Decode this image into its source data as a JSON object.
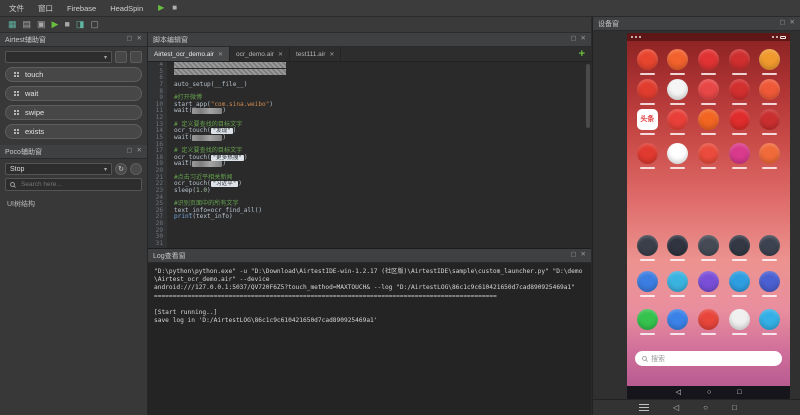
{
  "menubar": {
    "items": [
      "文件",
      "窗口",
      "Firebase",
      "HeadSpin"
    ]
  },
  "menubar_icons": [
    {
      "name": "play-icon",
      "glyph": "▶",
      "color": "#6abf40"
    },
    {
      "name": "stop-icon",
      "glyph": "■",
      "color": "#b0b0b0"
    }
  ],
  "toolbar": {
    "icons": [
      {
        "name": "new-script-icon",
        "glyph": "▦",
        "color": "#5fb3a1"
      },
      {
        "name": "open-script-icon",
        "glyph": "▤",
        "color": "#a8a8a8"
      },
      {
        "name": "save-script-icon",
        "glyph": "▣",
        "color": "#a8a8a8"
      },
      {
        "name": "run-script-icon",
        "glyph": "▶",
        "color": "#6abf40"
      },
      {
        "name": "stop-script-icon",
        "glyph": "■",
        "color": "#a8a8a8"
      },
      {
        "name": "snapshot-icon",
        "glyph": "◨",
        "color": "#5fb3a1"
      },
      {
        "name": "settings-icon",
        "glyph": "▢",
        "color": "#a8a8a8"
      }
    ]
  },
  "left": {
    "airtest": {
      "title": "Airtest辅助窗",
      "actions": [
        "touch",
        "wait",
        "swipe",
        "exists"
      ]
    },
    "poco": {
      "title": "Poco辅助窗",
      "mode": "Stop",
      "search_placeholder": "Search here...",
      "tree_label": "UI树结构"
    }
  },
  "editor": {
    "title": "脚本编辑窗",
    "add_tab": "+",
    "tabs": [
      {
        "label": "Airtest_ocr_demo.air",
        "active": true
      },
      {
        "label": "ocr_demo.air",
        "active": false
      },
      {
        "label": "test111.air",
        "active": false
      }
    ],
    "lines": [
      {
        "n": 4,
        "seg": [
          {
            "s": "redact"
          }
        ]
      },
      {
        "n": 5,
        "seg": [
          {
            "s": "redact"
          }
        ]
      },
      {
        "n": 6,
        "seg": []
      },
      {
        "n": 7,
        "seg": [
          {
            "t": "auto_setup(__file__)",
            "s": "d"
          }
        ]
      },
      {
        "n": 8,
        "seg": []
      },
      {
        "n": 9,
        "seg": [
          {
            "t": "#打开微博",
            "s": "c"
          }
        ]
      },
      {
        "n": 10,
        "seg": [
          {
            "t": "start_app(",
            "s": "d"
          },
          {
            "t": "\"com.sina.weibo\"",
            "s": "s"
          },
          {
            "t": ")",
            "s": "d"
          }
        ]
      },
      {
        "n": 11,
        "seg": [
          {
            "t": "wait(",
            "s": "d"
          },
          {
            "s": "thumb"
          },
          {
            "t": ")",
            "s": "d"
          }
        ]
      },
      {
        "n": 12,
        "seg": []
      },
      {
        "n": 13,
        "seg": [
          {
            "t": "# 定义要查找的目标文字",
            "s": "c"
          }
        ]
      },
      {
        "n": 14,
        "seg": [
          {
            "t": "ocr_touch(",
            "s": "d"
          },
          {
            "t": "\"发现\"",
            "s": "chip"
          },
          {
            "t": ")",
            "s": "d"
          }
        ]
      },
      {
        "n": 15,
        "seg": [
          {
            "t": "wait(",
            "s": "d"
          },
          {
            "s": "thumb"
          },
          {
            "t": ")",
            "s": "d"
          }
        ]
      },
      {
        "n": 16,
        "seg": []
      },
      {
        "n": 17,
        "seg": [
          {
            "t": "# 定义要查找的目标文字",
            "s": "c"
          }
        ]
      },
      {
        "n": 18,
        "seg": [
          {
            "t": "ocr_touch(",
            "s": "d"
          },
          {
            "t": "\"更多热搜\"",
            "s": "chip"
          },
          {
            "t": ")",
            "s": "d"
          }
        ]
      },
      {
        "n": 19,
        "seg": [
          {
            "t": "wait(",
            "s": "d"
          },
          {
            "s": "thumb"
          },
          {
            "t": ")",
            "s": "d"
          }
        ]
      },
      {
        "n": 20,
        "seg": []
      },
      {
        "n": 21,
        "seg": [
          {
            "t": "#点击习近平相关新闻",
            "s": "c"
          }
        ]
      },
      {
        "n": 22,
        "seg": [
          {
            "t": "ocr_touch(",
            "s": "d"
          },
          {
            "t": "\"习近平\"",
            "s": "chip"
          },
          {
            "t": ")",
            "s": "d"
          }
        ]
      },
      {
        "n": 23,
        "seg": [
          {
            "t": "sleep(",
            "s": "d"
          },
          {
            "t": "1.0",
            "s": "n"
          },
          {
            "t": ")",
            "s": "d"
          }
        ]
      },
      {
        "n": 24,
        "seg": []
      },
      {
        "n": 25,
        "seg": [
          {
            "t": "#识别页面中的所有文字",
            "s": "c"
          }
        ]
      },
      {
        "n": 26,
        "seg": [
          {
            "t": "text_info=ocr_find_all()",
            "s": "d"
          }
        ]
      },
      {
        "n": 27,
        "seg": [
          {
            "t": "print",
            "s": "k"
          },
          {
            "t": "(text_info)",
            "s": "d"
          }
        ]
      },
      {
        "n": 28,
        "seg": []
      },
      {
        "n": 29,
        "seg": []
      },
      {
        "n": 30,
        "seg": []
      },
      {
        "n": 31,
        "seg": []
      }
    ]
  },
  "log": {
    "title": "Log查看窗",
    "lines": [
      "\"D:\\python\\python.exe\" -u \"D:\\Download\\AirtestIDE-win-1.2.17 (社区版)\\AirtestIDE\\sample\\custom_launcher.py\" \"D:\\demo\\Airtest_ocr_demo.air\" --device",
      "android:///127.0.0.1:5037/QV720F6Z5?touch_method=MAXTOUCH& --log \"D:/AirtestLOG\\86c1c9c610421650d7cad890925469a1\"",
      "============================================================================================",
      "",
      "[Start running..]",
      "save log in 'D:/AirtestLOG\\86c1c9c610421650d7cad890925469a1'"
    ]
  },
  "device": {
    "title": "设备窗",
    "search_placeholder": "搜索",
    "toutiao_label": "头条",
    "grid": {
      "row_tops": [
        8,
        38,
        68,
        102,
        194,
        230,
        268
      ],
      "rows": [
        {
          "type": "app",
          "colors": [
            "#e8452f",
            "#f2622d",
            "#e13333",
            "#cf2f2f",
            "#f09a2e"
          ]
        },
        {
          "type": "app",
          "colors": [
            "#e13d2f",
            "#f5f5f5",
            "#e84747",
            "#d22f2f",
            "#ef5937"
          ]
        },
        {
          "type": "app-toutiao",
          "colors": [
            "#e84038",
            "#f26522",
            "#df2c2c",
            "#c92f2f"
          ]
        },
        {
          "type": "app",
          "colors": [
            "#e0392f",
            "#ffffff",
            "#ea4b3c",
            "#d93a8c",
            "#f16a3a"
          ]
        },
        {
          "type": "round",
          "colors": [
            "#3a3f4a",
            "#2f3440",
            "#454a55",
            "#333844",
            "#3d4250"
          ]
        },
        {
          "type": "round",
          "colors": [
            "#3b7de0",
            "#3bb3e0",
            "#7a4fd8",
            "#2f9ee0",
            "#4a5fd0"
          ]
        },
        {
          "type": "round",
          "colors": [
            "#35c24d",
            "#3b82e8",
            "#e8453b",
            "#f0f0f0",
            "#34b0e6"
          ]
        }
      ]
    }
  },
  "icons": {
    "close": "✕",
    "float": "▢",
    "caret": "▾",
    "refresh": "↻",
    "back": "◁",
    "home": "○",
    "recents": "□"
  }
}
